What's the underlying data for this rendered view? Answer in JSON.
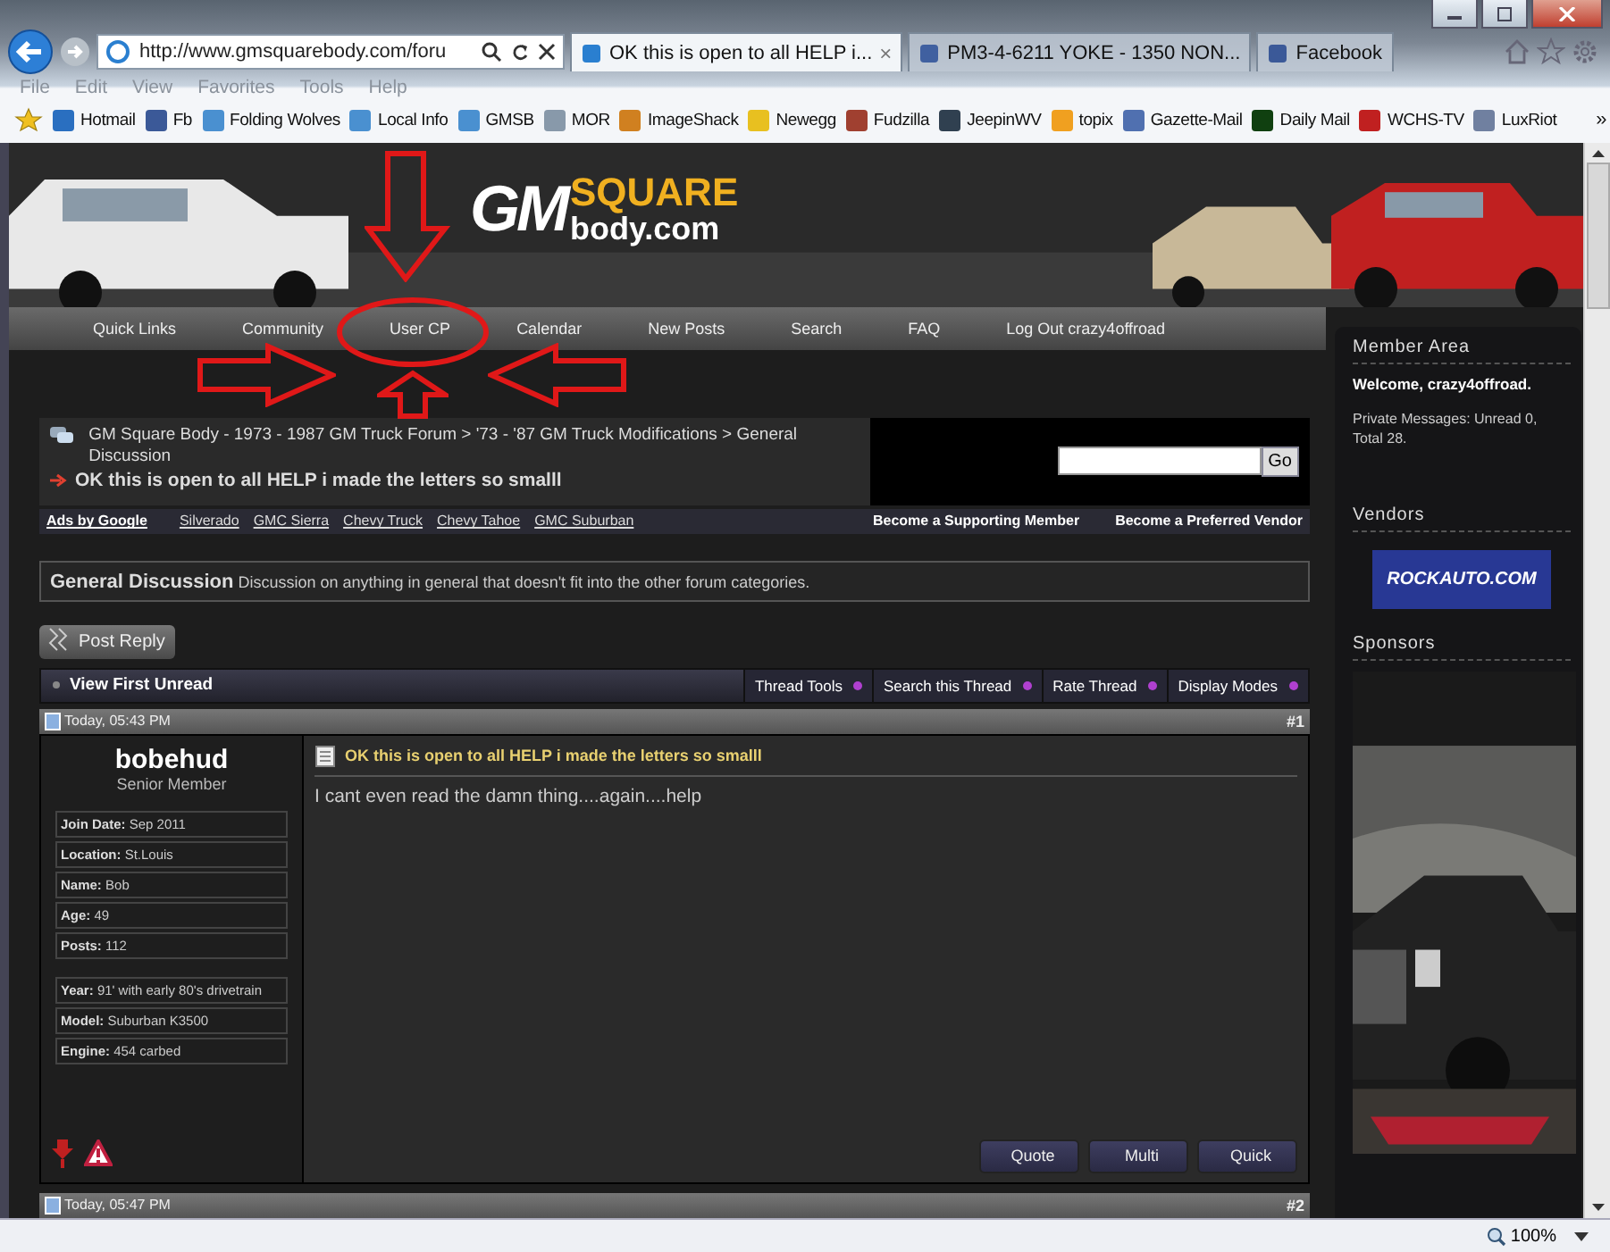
{
  "browser": {
    "address": "http://www.gmsquarebody.com/foru",
    "tabs": [
      {
        "title": "OK this is open to all HELP i...",
        "selected": true,
        "close": "×"
      },
      {
        "title": "PM3-4-6211 YOKE - 1350 NON...",
        "selected": false
      },
      {
        "title": "Facebook",
        "selected": false
      }
    ],
    "menu": [
      "File",
      "Edit",
      "View",
      "Favorites",
      "Tools",
      "Help"
    ],
    "favorites": [
      "Hotmail",
      "Fb",
      "Folding Wolves",
      "Local Info",
      "GMSB",
      "MOR",
      "ImageShack",
      "Newegg",
      "Fudzilla",
      "JeepinWV",
      "topix",
      "Gazette-Mail",
      "Daily Mail",
      "WCHS-TV",
      "LuxRiot"
    ],
    "more": "»",
    "zoom": "100%"
  },
  "site": {
    "logo": {
      "top": "SQUARE",
      "gm": "GM",
      "bottom": "body.com"
    },
    "nav": [
      "Quick Links",
      "Community",
      "User CP",
      "Calendar",
      "New Posts",
      "Search",
      "FAQ",
      "Log Out crazy4offroad"
    ],
    "breadcrumb": {
      "path": "GM Square Body - 1973 - 1987 GM Truck Forum > '73 - '87 GM Truck Modifications > General Discussion",
      "title": "OK this is open to all HELP i made the letters so smalll"
    },
    "search_button": "Go",
    "ads": {
      "label": "Ads by Google",
      "links": [
        "Silverado",
        "GMC Sierra",
        "Chevy Truck",
        "Chevy Tahoe",
        "GMC Suburban"
      ]
    },
    "promo_links": [
      "Become a Supporting Member",
      "Become a Preferred Vendor"
    ],
    "forum": "**General Discussion** Discussion on anything in general that doesn't fit into the other forum categories.",
    "post_reply": "Post Reply",
    "thread_bar": {
      "first_unread": "View First Unread",
      "tools": [
        "Thread Tools",
        "Search this Thread",
        "Rate Thread",
        "Display Modes"
      ]
    },
    "post": {
      "date": "Today, 05:43 PM",
      "number": "#1",
      "user": "bobehud",
      "rank": "Senior Member",
      "fields": [
        "**Join Date:** Sep 2011",
        "**Location:** St.Louis",
        "**Name:** Bob",
        "**Age:** 49",
        "**Posts:** 112"
      ],
      "vehicle": [
        "**Year:** 91' with early 80's drivetrain",
        "**Model:** Suburban K3500",
        "**Engine:** 454 carbed"
      ],
      "title": "OK this is open to all HELP i made the letters so smalll",
      "body": "I cant even read the damn thing....again....help",
      "buttons": [
        "Quote",
        "Multi",
        "Quick"
      ]
    },
    "next_post": {
      "date": "Today, 05:47 PM",
      "number": "#2"
    }
  },
  "sidebar": {
    "member_title": "Member Area",
    "welcome": "Welcome, crazy4offroad.",
    "messages": "Private Messages: Unread 0, Total 28.",
    "vendors_title": "Vendors",
    "vendor_banner": "ROCKAUTO.COM",
    "sponsors_title": "Sponsors"
  }
}
